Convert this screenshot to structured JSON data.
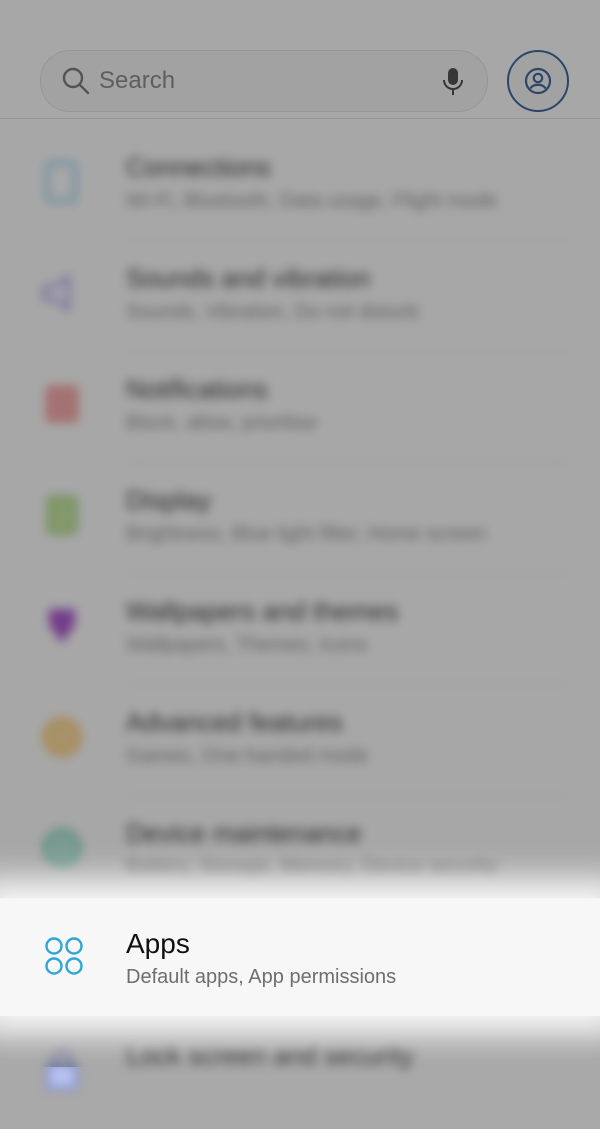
{
  "search": {
    "placeholder": "Search"
  },
  "menu": [
    {
      "title": "Connections",
      "subtitle": "Wi-Fi, Bluetooth, Data usage, Flight mode",
      "icon": "connections-icon",
      "color": "#63b6e6"
    },
    {
      "title": "Sounds and vibration",
      "subtitle": "Sounds, Vibration, Do not disturb",
      "icon": "sound-icon",
      "color": "#8f7de8"
    },
    {
      "title": "Notifications",
      "subtitle": "Block, allow, prioritise",
      "icon": "notifications-icon",
      "color": "#ef6d6d"
    },
    {
      "title": "Display",
      "subtitle": "Brightness, Blue light filter, Home screen",
      "icon": "display-icon",
      "color": "#7dbf4e"
    },
    {
      "title": "Wallpapers and themes",
      "subtitle": "Wallpapers, Themes, Icons",
      "icon": "wallpapers-icon",
      "color": "#9b3fc3"
    },
    {
      "title": "Advanced features",
      "subtitle": "Games, One-handed mode",
      "icon": "advanced-features-icon",
      "color": "#f2b54a"
    },
    {
      "title": "Device maintenance",
      "subtitle": "Battery, Storage, Memory, Device security",
      "icon": "device-maintenance-icon",
      "color": "#56c2a4"
    },
    {
      "title": "Apps",
      "subtitle": "Default apps, App permissions",
      "icon": "apps-icon",
      "color": "#2ea6d6"
    },
    {
      "title": "Lock screen and security",
      "subtitle": "",
      "icon": "lock-icon",
      "color": "#6a7fd8"
    }
  ]
}
